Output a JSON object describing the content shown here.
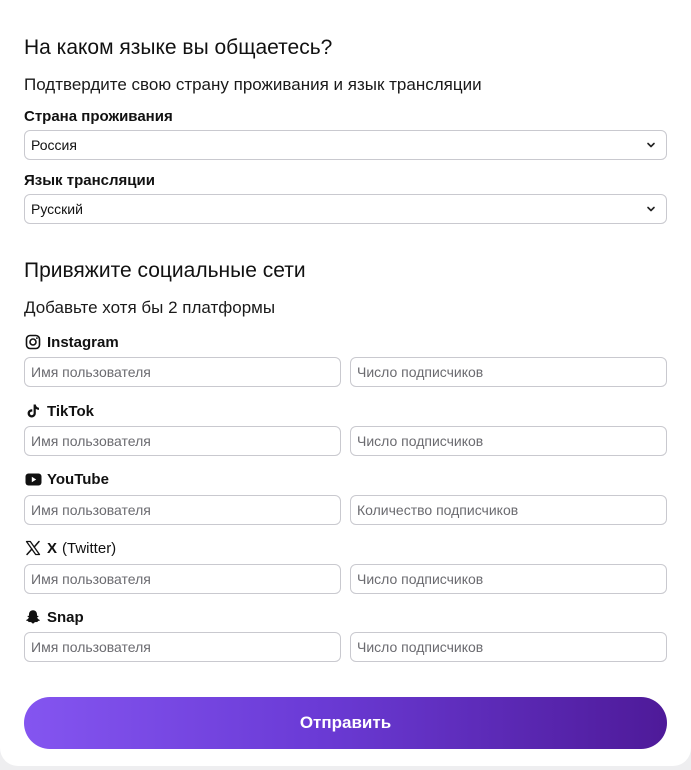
{
  "language_section": {
    "title": "На каком языке вы общаетесь?",
    "subtitle": "Подтвердите свою страну проживания и язык трансляции",
    "country_label": "Страна проживания",
    "country_value": "Россия",
    "language_label": "Язык трансляции",
    "language_value": "Русский"
  },
  "social_section": {
    "title": "Привяжите социальные сети",
    "subtitle": "Добавьте хотя бы 2 платформы",
    "platforms": [
      {
        "name": "Instagram",
        "icon": "instagram-icon",
        "username_placeholder": "Имя пользователя",
        "followers_placeholder": "Число подписчиков"
      },
      {
        "name": "TikTok",
        "icon": "tiktok-icon",
        "username_placeholder": "Имя пользователя",
        "followers_placeholder": "Число подписчиков"
      },
      {
        "name": "YouTube",
        "icon": "youtube-icon",
        "username_placeholder": "Имя пользователя",
        "followers_placeholder": "Количество подписчиков"
      },
      {
        "name": "X",
        "name_suffix": "(Twitter)",
        "icon": "x-icon",
        "username_placeholder": "Имя пользователя",
        "followers_placeholder": "Число подписчиков"
      },
      {
        "name": "Snap",
        "icon": "snapchat-icon",
        "username_placeholder": "Имя пользователя",
        "followers_placeholder": "Число подписчиков"
      }
    ]
  },
  "submit_label": "Отправить",
  "colors": {
    "accent_start": "#8455f0",
    "accent_end": "#4e1a99",
    "border": "#c9c9cf"
  }
}
